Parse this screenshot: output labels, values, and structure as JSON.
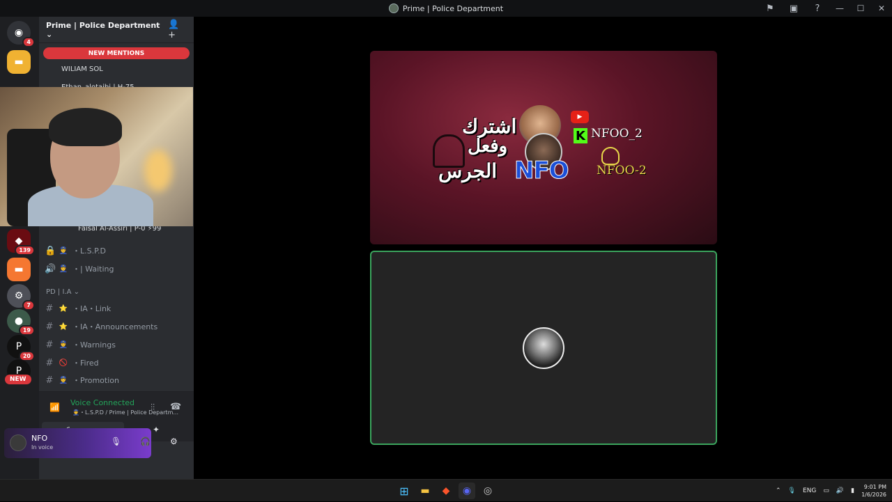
{
  "window": {
    "title": "Prime | Police Department"
  },
  "server": {
    "name": "Prime | Police Department",
    "chevron": "⌄"
  },
  "banner": {
    "new_mentions": "NEW MENTIONS"
  },
  "voice_users": [
    "WILIAM SOL",
    "Ethan_alotaibi | H-75",
    "Faisal Al-Assiri | P-0 ⚡99"
  ],
  "channels": [
    {
      "type": "locked-text",
      "icon": "🔒",
      "emoji": "👮",
      "label": "・L.S.P.D"
    },
    {
      "type": "voice",
      "icon": "🔊",
      "emoji": "👮",
      "label": "・| Waiting"
    }
  ],
  "category": {
    "name": "PD | I.A",
    "chevron": "⌄"
  },
  "ia_channels": [
    {
      "icon": "#",
      "emoji": "⭐",
      "label": "・IA・Link"
    },
    {
      "icon": "#",
      "emoji": "⭐",
      "label": "・IA・Announcements"
    },
    {
      "icon": "#",
      "emoji": "👮",
      "label": "・Warnings"
    },
    {
      "icon": "#",
      "emoji": "🚫",
      "label": "・Fired"
    },
    {
      "icon": "#",
      "emoji": "👮",
      "label": "・Promotion"
    }
  ],
  "guild_badges": [
    "4",
    "139",
    "7",
    "19",
    "20"
  ],
  "guild_new": "NEW",
  "voice_panel": {
    "status": "Voice Connected",
    "location": "👮・L.S.P.D / Prime | Police Departm..."
  },
  "user": {
    "name": "NFO",
    "status": "In voice"
  },
  "stream": {
    "arabic_line1": "اشترك",
    "arabic_line2": "وفعل",
    "arabic_line3": "الجرس",
    "nfo_logo": "NFO",
    "handle_kick": "NFOO_2",
    "handle_snap": "NFOO-2",
    "yt_play": "▶",
    "kick_letter": "K"
  },
  "taskbar": {
    "language": "ENG",
    "time": "9:01 PM",
    "date": "1/6/2026"
  },
  "colors": {
    "accent_red": "#da373c",
    "voice_green": "#23a55a",
    "frame_green": "#3ba55d"
  }
}
